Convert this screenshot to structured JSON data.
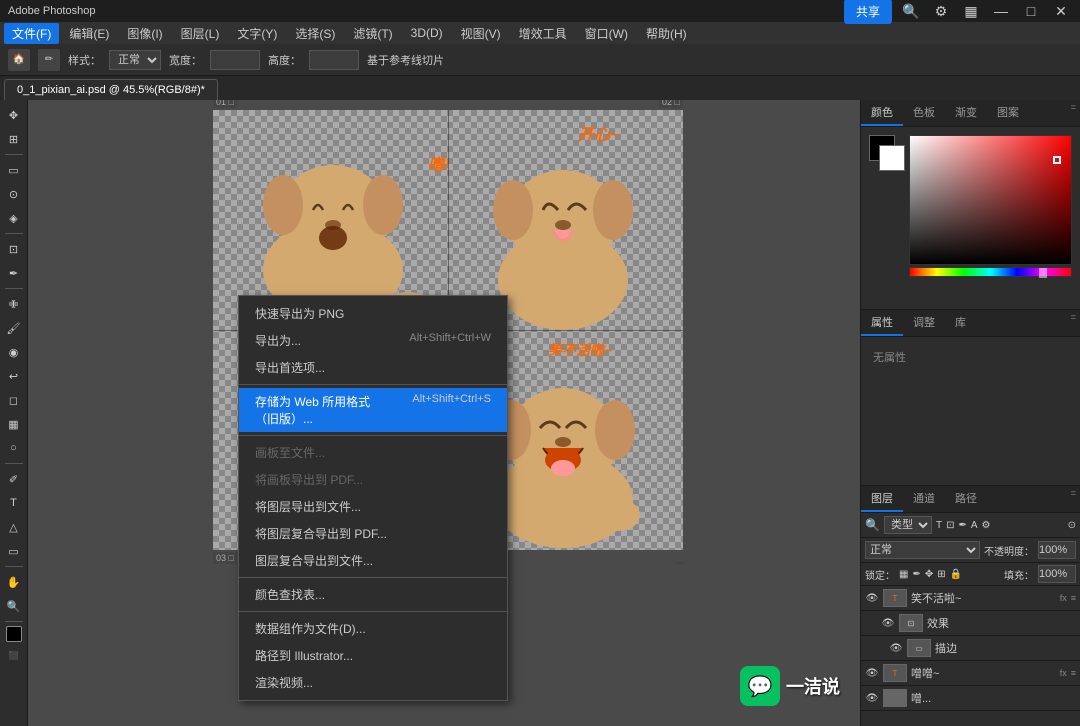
{
  "titlebar": {
    "title": "Adobe Photoshop",
    "share_label": "共享"
  },
  "menubar": {
    "items": [
      "文件(F)",
      "编辑(E)",
      "图像(I)",
      "图层(L)",
      "文字(Y)",
      "选择(S)",
      "滤镜(T)",
      "3D(D)",
      "视图(V)",
      "增效工具",
      "窗口(W)",
      "帮助(H)"
    ]
  },
  "toolbar": {
    "style_label": "样式：",
    "style_value": "正常",
    "width_label": "宽度：",
    "height_label": "高度：",
    "hint_label": "基于参考线切片"
  },
  "tab": {
    "filename": "0_1_pixian_ai.psd @ 45.5%(RGB/8#)*"
  },
  "context_menu": {
    "items": [
      {
        "label": "快速导出为 PNG",
        "shortcut": "",
        "active": false,
        "disabled": false
      },
      {
        "label": "导出为...",
        "shortcut": "Alt+Shift+Ctrl+W",
        "active": false,
        "disabled": false
      },
      {
        "label": "导出首选项...",
        "shortcut": "",
        "active": false,
        "disabled": false
      },
      {
        "label": "存储为 Web 所用格式（旧版）...",
        "shortcut": "Alt+Shift+Ctrl+S",
        "active": true,
        "disabled": false
      },
      {
        "label": "画板至文件...",
        "shortcut": "",
        "active": false,
        "disabled": true
      },
      {
        "label": "将画板导出到 PDF...",
        "shortcut": "",
        "active": false,
        "disabled": true
      },
      {
        "label": "将图层导出到文件...",
        "shortcut": "",
        "active": false,
        "disabled": false
      },
      {
        "label": "将图层复合导出到 PDF...",
        "shortcut": "",
        "active": false,
        "disabled": false
      },
      {
        "label": "图层复合导出到文件...",
        "shortcut": "",
        "active": false,
        "disabled": false
      },
      {
        "label": "颜色查找表...",
        "shortcut": "",
        "active": false,
        "disabled": false
      },
      {
        "label": "数据组作为文件(D)...",
        "shortcut": "",
        "active": false,
        "disabled": false
      },
      {
        "label": "路径到 Illustrator...",
        "shortcut": "",
        "active": false,
        "disabled": false
      },
      {
        "label": "渲染视频...",
        "shortcut": "",
        "active": false,
        "disabled": false
      }
    ]
  },
  "canvas_texts": [
    {
      "text": "噌噌~",
      "position": "top-left"
    },
    {
      "text": "开心~",
      "position": "top-right"
    },
    {
      "text": "笑不活啦~",
      "position": "bottom-right"
    }
  ],
  "right_panel": {
    "color_tabs": [
      "颜色",
      "色板",
      "渐变",
      "图案"
    ],
    "props_tabs": [
      "属性",
      "调整",
      "库"
    ],
    "no_attributes": "无属性",
    "layers_tabs": [
      "图层",
      "通道",
      "路径"
    ],
    "layers_filter_label": "类型",
    "blend_mode": "正常",
    "opacity_label": "不透明度：",
    "opacity_value": "100%",
    "fill_label": "填充：",
    "fill_value": "100%",
    "layers": [
      {
        "name": "笑不活啦~",
        "type": "T",
        "fx": "fx",
        "eye": true
      },
      {
        "name": "效果",
        "type": "",
        "fx": "",
        "eye": true,
        "indent": true
      },
      {
        "name": "描边",
        "type": "",
        "fx": "",
        "eye": true,
        "indent": true
      },
      {
        "name": "噌噌~",
        "type": "T",
        "fx": "fx",
        "eye": true
      },
      {
        "name": "噌...",
        "type": "",
        "fx": "",
        "eye": true,
        "indent": false
      }
    ]
  },
  "watermark": {
    "icon": "💬",
    "text": "一洁说"
  },
  "icons": {
    "search": "🔍",
    "settings": "⚙",
    "minimize": "—",
    "maximize": "□",
    "close": "✕",
    "eye": "👁",
    "move": "✥",
    "lasso": "⊙",
    "crop": "⊞",
    "eyedropper": "✒",
    "brush": "🖌",
    "clone": "◉",
    "eraser": "◻",
    "gradient": "▦",
    "hand": "✋",
    "zoom": "🔍"
  }
}
